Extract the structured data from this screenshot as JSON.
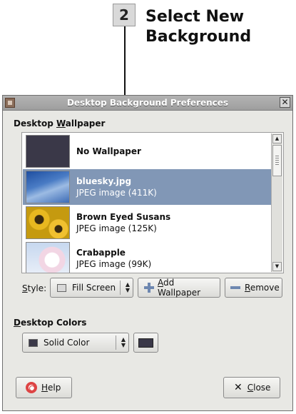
{
  "callout": {
    "number": "2",
    "text": "Select New\nBackground"
  },
  "window": {
    "title": "Desktop Background Preferences",
    "close_glyph": "✕"
  },
  "wallpaper_section": {
    "label_pre": "Desktop ",
    "label_mnemonic": "W",
    "label_post": "allpaper"
  },
  "wallpapers": [
    {
      "name": "No Wallpaper",
      "type": ""
    },
    {
      "name": "bluesky.jpg",
      "type": "JPEG image (411K)",
      "selected": true
    },
    {
      "name": "Brown Eyed Susans",
      "type": "JPEG image (125K)"
    },
    {
      "name": "Crabapple",
      "type": "JPEG image (99K)"
    }
  ],
  "style": {
    "label_mnemonic": "S",
    "label_post": "tyle:",
    "value": "Fill Screen"
  },
  "add_wallpaper": {
    "mnemonic": "A",
    "label_post": "dd Wallpaper"
  },
  "remove": {
    "mnemonic": "R",
    "label_post": "emove"
  },
  "colors_section": {
    "label_mnemonic": "D",
    "label_post": "esktop Colors",
    "mode": "Solid Color",
    "color": "#3a3848"
  },
  "help": {
    "mnemonic": "H",
    "label_post": "elp"
  },
  "close": {
    "mnemonic": "C",
    "label_post": "lose"
  },
  "colors": {
    "selection": "#8197b6",
    "window_bg": "#e8e8e4",
    "swatch": "#3a3848"
  }
}
